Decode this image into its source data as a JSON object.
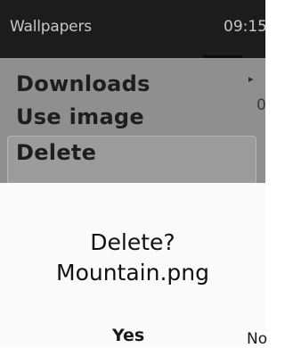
{
  "status": {
    "title": "Wallpapers",
    "time": "09:15"
  },
  "menu": {
    "items": [
      {
        "label": "Downloads",
        "has_submenu": true
      },
      {
        "label": "Use image"
      },
      {
        "label": "Delete",
        "highlighted": true
      }
    ],
    "edge_fragment": "0"
  },
  "dialog": {
    "title": "Delete?",
    "filename": "Mountain.png",
    "yes_label": "Yes",
    "no_label": "No"
  }
}
